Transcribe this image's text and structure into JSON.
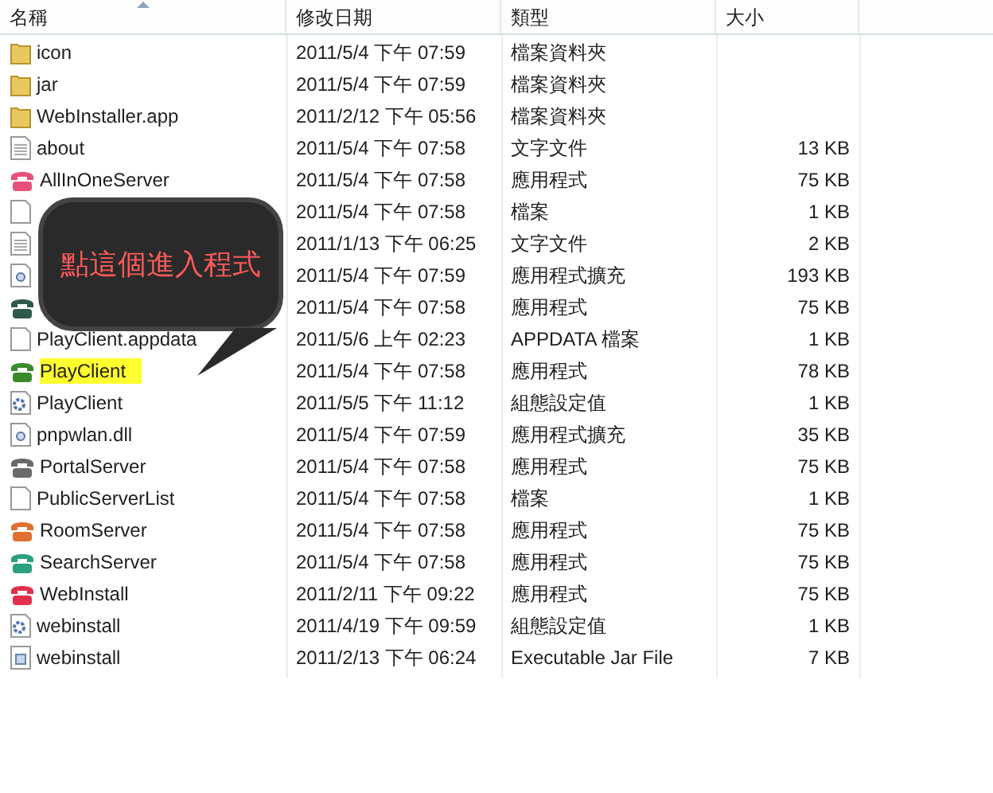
{
  "columns": [
    {
      "label": "名稱",
      "sorted": true
    },
    {
      "label": "修改日期",
      "sorted": false
    },
    {
      "label": "類型",
      "sorted": false
    },
    {
      "label": "大小",
      "sorted": false
    }
  ],
  "rows": [
    {
      "kind": "folder",
      "name": "icon",
      "date": "2011/5/4 下午 07:59",
      "type": "檔案資料夾"
    },
    {
      "kind": "folder",
      "name": "jar",
      "date": "2011/5/4 下午 07:59",
      "type": "檔案資料夾"
    },
    {
      "kind": "folder",
      "name": "WebInstaller.app",
      "date": "2011/2/12 下午 05:56",
      "type": "檔案資料夾"
    },
    {
      "kind": "text",
      "name": "about",
      "date": "2011/5/4 下午 07:58",
      "type": "文字文件",
      "size": "13 KB"
    },
    {
      "kind": "app",
      "color": "#e8507a",
      "name": "AllInOneServer",
      "date": "2011/5/4 下午 07:58",
      "type": "應用程式",
      "size": "75 KB"
    },
    {
      "kind": "file",
      "date": "2011/5/4 下午 07:58",
      "type": "檔案",
      "size": "1 KB"
    },
    {
      "kind": "text",
      "date": "2011/1/13 下午 06:25",
      "type": "文字文件",
      "size": "2 KB"
    },
    {
      "kind": "dll",
      "date": "2011/5/4 下午 07:59",
      "type": "應用程式擴充",
      "size": "193 KB"
    },
    {
      "kind": "app",
      "color": "#2e5a4a",
      "date": "2011/5/4 下午 07:58",
      "type": "應用程式",
      "size": "75 KB"
    },
    {
      "kind": "file",
      "name": "PlayClient.appdata",
      "date": "2011/5/6 上午 02:23",
      "type": "APPDATA 檔案",
      "size": "1 KB"
    },
    {
      "kind": "app",
      "color": "#3a8a2a",
      "name": "PlayClient",
      "date": "2011/5/4 下午 07:58",
      "type": "應用程式",
      "size": "78 KB",
      "highlighted": true
    },
    {
      "kind": "config",
      "name": "PlayClient",
      "date": "2011/5/5 下午 11:12",
      "type": "組態設定值",
      "size": "1 KB"
    },
    {
      "kind": "dll",
      "name": "pnpwlan.dll",
      "date": "2011/5/4 下午 07:59",
      "type": "應用程式擴充",
      "size": "35 KB"
    },
    {
      "kind": "app",
      "color": "#6a6a6a",
      "name": "PortalServer",
      "date": "2011/5/4 下午 07:58",
      "type": "應用程式",
      "size": "75 KB"
    },
    {
      "kind": "file",
      "name": "PublicServerList",
      "date": "2011/5/4 下午 07:58",
      "type": "檔案",
      "size": "1 KB"
    },
    {
      "kind": "app",
      "color": "#e07030",
      "name": "RoomServer",
      "date": "2011/5/4 下午 07:58",
      "type": "應用程式",
      "size": "75 KB"
    },
    {
      "kind": "app",
      "color": "#2aa080",
      "name": "SearchServer",
      "date": "2011/5/4 下午 07:58",
      "type": "應用程式",
      "size": "75 KB"
    },
    {
      "kind": "app",
      "color": "#e0304a",
      "name": "WebInstall",
      "date": "2011/2/11 下午 09:22",
      "type": "應用程式",
      "size": "75 KB"
    },
    {
      "kind": "config",
      "name": "webinstall",
      "date": "2011/4/19 下午 09:59",
      "type": "組態設定值",
      "size": "1 KB"
    },
    {
      "kind": "jar",
      "name": "webinstall",
      "date": "2011/2/13 下午 06:24",
      "type": "Executable Jar File",
      "size": "7 KB"
    }
  ],
  "callout": {
    "text": "點這個進入程式"
  }
}
